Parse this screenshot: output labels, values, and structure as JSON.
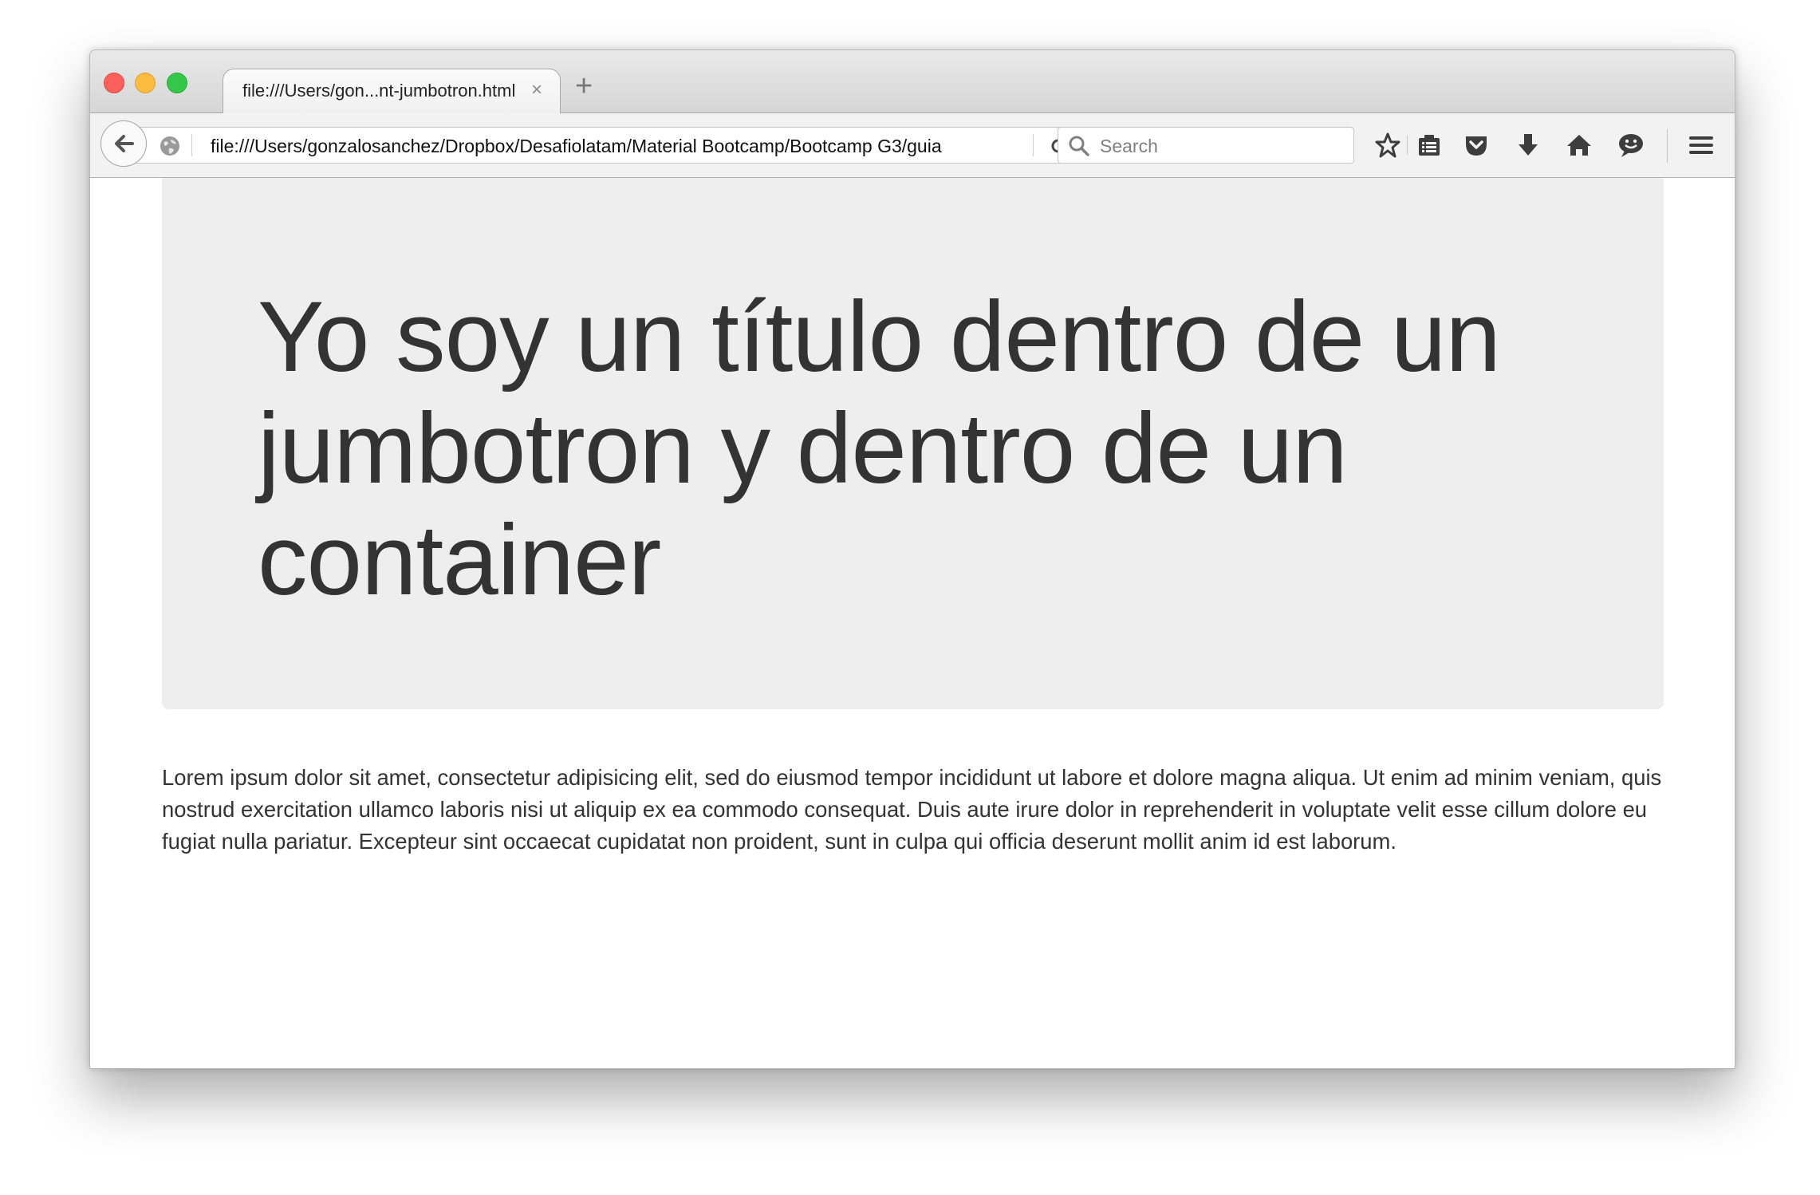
{
  "browser": {
    "tab_title": "file:///Users/gon...nt-jumbotron.html",
    "tab_close": "×",
    "new_tab": "+",
    "url": "file:///Users/gonzalosanchez/Dropbox/Desafiolatam/Material Bootcamp/Bootcamp G3/guia",
    "search_placeholder": "Search"
  },
  "page": {
    "jumbotron_title": "Yo soy un título dentro de un jumbotron y dentro de un container",
    "paragraph": "Lorem ipsum dolor sit amet, consectetur adipisicing elit, sed do eiusmod tempor incididunt ut labore et dolore magna aliqua. Ut enim ad minim veniam, quis nostrud exercitation ullamco laboris nisi ut aliquip ex ea commodo consequat. Duis aute irure dolor in reprehenderit in voluptate velit esse cillum dolore eu fugiat nulla pariatur. Excepteur sint occaecat cupidatat non proident, sunt in culpa qui officia deserunt mollit anim id est laborum."
  },
  "colors": {
    "jumbotron_bg": "#eeeeee",
    "text": "#333333",
    "traffic_close": "#fc605c",
    "traffic_minimize": "#fdbc40",
    "traffic_maximize": "#34c84a"
  },
  "icons": [
    "back-arrow-icon",
    "globe-icon",
    "reload-icon",
    "search-icon",
    "bookmark-star-icon",
    "reading-list-icon",
    "pocket-icon",
    "download-icon",
    "home-icon",
    "chat-icon",
    "hamburger-menu-icon"
  ]
}
